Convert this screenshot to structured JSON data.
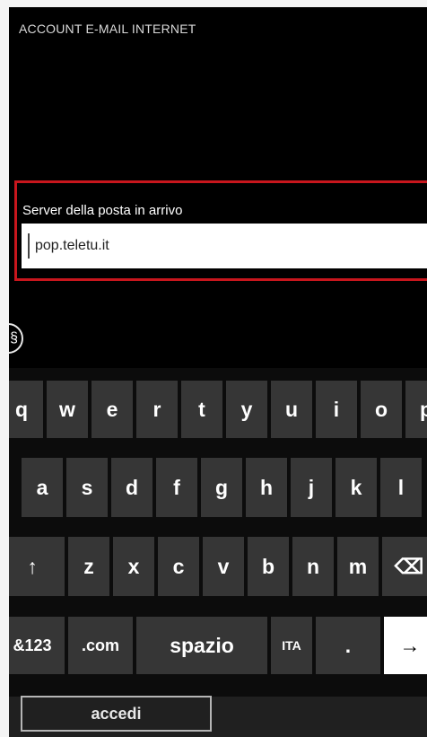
{
  "header": {
    "title": "ACCOUNT  E-MAIL INTERNET"
  },
  "form": {
    "incoming_server_label": "Server della posta in arrivo",
    "incoming_server_value": "pop.teletu.it"
  },
  "side_button": {
    "glyph": "§",
    "icon": "circle-icon"
  },
  "keyboard": {
    "row1": [
      "q",
      "w",
      "e",
      "r",
      "t",
      "y",
      "u",
      "i",
      "o",
      "p"
    ],
    "row2": [
      "a",
      "s",
      "d",
      "f",
      "g",
      "h",
      "j",
      "k",
      "l"
    ],
    "row3_letters": [
      "z",
      "x",
      "c",
      "v",
      "b",
      "n",
      "m"
    ],
    "shift_glyph": "↑",
    "backspace_glyph": "⌫",
    "symbols_label": "&123",
    "com_label": ".com",
    "space_label": "spazio",
    "lang_label": "ITA",
    "period_label": ".",
    "enter_glyph": "→"
  },
  "actions": {
    "accedi_label": "accedi"
  },
  "colors": {
    "highlight": "#c8161d",
    "key": "#363636",
    "screen": "#000000"
  }
}
